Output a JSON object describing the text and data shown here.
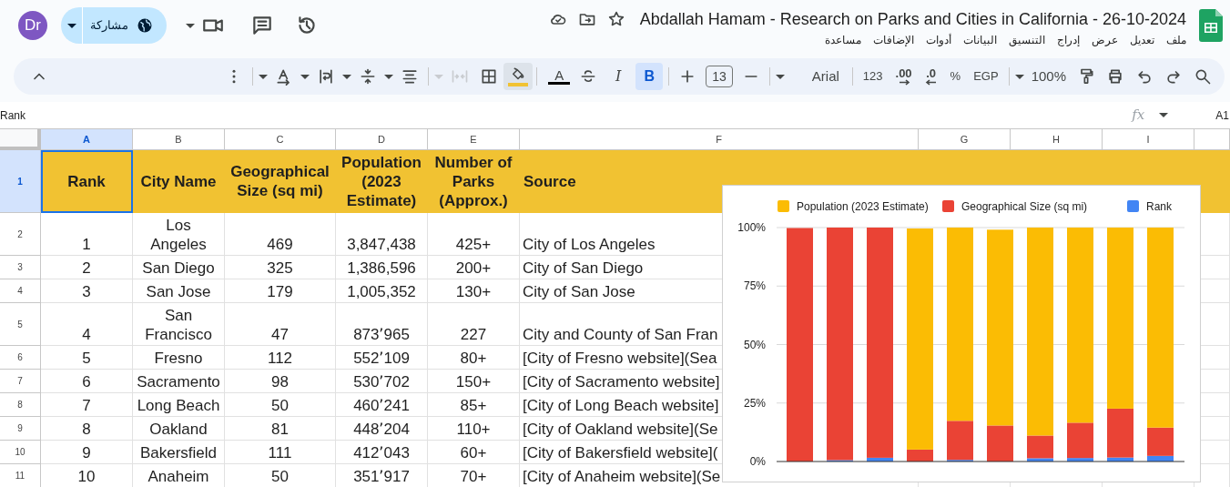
{
  "topbar": {
    "avatar": "Dr",
    "share": "مشاركة",
    "title": "Abdallah Hamam - Research on Parks and Cities in California - 26-10-2024",
    "menu": [
      "ملف",
      "تعديل",
      "عرض",
      "إدراج",
      "التنسيق",
      "البيانات",
      "أدوات",
      "الإضافات",
      "مساعدة"
    ]
  },
  "toolbar": [
    {
      "kind": "collapse",
      "disabled": false
    },
    {
      "kind": "spacer"
    },
    {
      "kind": "more",
      "disabled": false
    },
    {
      "kind": "divider"
    },
    {
      "kind": "caret",
      "disabled": false
    },
    {
      "kind": "rotate",
      "disabled": false
    },
    {
      "kind": "caret",
      "disabled": false
    },
    {
      "kind": "wrap",
      "disabled": false
    },
    {
      "kind": "caret",
      "disabled": false
    },
    {
      "kind": "valign",
      "disabled": false
    },
    {
      "kind": "caret",
      "disabled": false
    },
    {
      "kind": "halign",
      "disabled": false
    },
    {
      "kind": "divider"
    },
    {
      "kind": "caret",
      "disabled": true
    },
    {
      "kind": "merge",
      "disabled": true
    },
    {
      "kind": "borders",
      "disabled": false
    },
    {
      "kind": "fill",
      "disabled": false,
      "color": "#f1c232"
    },
    {
      "kind": "divider"
    },
    {
      "kind": "textcolor",
      "disabled": false,
      "label": "A",
      "color": "#000000"
    },
    {
      "kind": "strike",
      "disabled": false,
      "active": false
    },
    {
      "kind": "italic",
      "disabled": false,
      "label": "I",
      "active": false
    },
    {
      "kind": "bold",
      "disabled": false,
      "label": "B",
      "active": true
    },
    {
      "kind": "divider"
    },
    {
      "kind": "plus",
      "disabled": false
    },
    {
      "kind": "size",
      "disabled": false,
      "label": "13"
    },
    {
      "kind": "minus",
      "disabled": false
    },
    {
      "kind": "divider"
    },
    {
      "kind": "caret",
      "disabled": false
    },
    {
      "kind": "font",
      "disabled": false,
      "label": "Arial"
    },
    {
      "kind": "divider"
    },
    {
      "kind": "format",
      "disabled": false,
      "label": "123"
    },
    {
      "kind": "decimal_add",
      "disabled": false,
      "label": ".00"
    },
    {
      "kind": "decimal_remove",
      "disabled": false,
      "label": ".0"
    },
    {
      "kind": "format",
      "disabled": false,
      "label": "%"
    },
    {
      "kind": "format",
      "disabled": false,
      "label": "EGP"
    },
    {
      "kind": "divider"
    },
    {
      "kind": "caret",
      "disabled": false
    },
    {
      "kind": "zoom",
      "disabled": false,
      "label": "100%"
    },
    {
      "kind": "paint",
      "disabled": false
    },
    {
      "kind": "print",
      "disabled": false
    },
    {
      "kind": "undo",
      "disabled": false
    },
    {
      "kind": "redo",
      "disabled": false
    },
    {
      "kind": "search",
      "disabled": false
    }
  ],
  "formula_bar": {
    "content": "Rank",
    "fx": "fx",
    "cell": "A1"
  },
  "sheet": {
    "columns": [
      {
        "label": "A",
        "selected": true
      },
      {
        "label": "B",
        "selected": false
      },
      {
        "label": "C",
        "selected": false
      },
      {
        "label": "D",
        "selected": false
      },
      {
        "label": "E",
        "selected": false
      },
      {
        "label": "F",
        "selected": false
      },
      {
        "label": "G",
        "selected": false
      },
      {
        "label": "H",
        "selected": false
      },
      {
        "label": "I",
        "selected": false
      }
    ],
    "rows": [
      {
        "number": "1",
        "selected": true,
        "cells": [
          "Rank",
          "City Name",
          "Geographical Size (sq mi)",
          "Population (2023 Estimate)",
          "Number of Parks (Approx.)",
          "Source"
        ]
      },
      {
        "number": "2",
        "selected": false,
        "cells": [
          "1",
          "Los Angeles",
          "469",
          "3,847,438",
          "425+",
          "City of Los Angeles"
        ]
      },
      {
        "number": "3",
        "selected": false,
        "cells": [
          "2",
          "San Diego",
          "325",
          "1,386,596",
          "200+",
          "City of San Diego"
        ]
      },
      {
        "number": "4",
        "selected": false,
        "cells": [
          "3",
          "San Jose",
          "179",
          "1,005,352",
          "130+",
          "City of San Jose"
        ]
      },
      {
        "number": "5",
        "selected": false,
        "cells": [
          "4",
          "San Francisco",
          "47",
          "873٬965",
          "227",
          "City and County of San Fran"
        ]
      },
      {
        "number": "6",
        "selected": false,
        "cells": [
          "5",
          "Fresno",
          "112",
          "552٬109",
          "80+",
          "[City of Fresno website](Sea"
        ]
      },
      {
        "number": "7",
        "selected": false,
        "cells": [
          "6",
          "Sacramento",
          "98",
          "530٬702",
          "150+",
          "[City of Sacramento website]"
        ]
      },
      {
        "number": "8",
        "selected": false,
        "cells": [
          "7",
          "Long Beach",
          "50",
          "460٬241",
          "85+",
          "[City of Long Beach website]"
        ]
      },
      {
        "number": "9",
        "selected": false,
        "cells": [
          "8",
          "Oakland",
          "81",
          "448٬204",
          "110+",
          "[City of Oakland website](Se"
        ]
      },
      {
        "number": "10",
        "selected": false,
        "cells": [
          "9",
          "Bakersfield",
          "111",
          "412٬043",
          "60+",
          "[City of Bakersfield website]("
        ]
      },
      {
        "number": "11",
        "selected": false,
        "cells": [
          "10",
          "Anaheim",
          "50",
          "351٬917",
          "70+",
          "[City of Anaheim website](Se"
        ]
      }
    ]
  },
  "chart": {
    "chart_data": {
      "type": "bar",
      "stacked": true,
      "legend": "top",
      "grid": true,
      "ylim": [
        0,
        100
      ],
      "yticks": [
        {
          "value": 0,
          "label": "0%"
        },
        {
          "value": 25,
          "label": "25%"
        },
        {
          "value": 50,
          "label": "50%"
        },
        {
          "value": 75,
          "label": "75%"
        },
        {
          "value": 100,
          "label": "100%"
        }
      ],
      "series": [
        {
          "name": "Rank",
          "color": "#4285f4",
          "values": [
            null,
            0.6,
            1.6,
            null,
            0.7,
            null,
            1.4,
            1.5,
            1.7,
            2.4
          ]
        },
        {
          "name": "Geographical Size (sq mi)",
          "color": "#ea4335",
          "values": [
            99.8,
            99.4,
            98.4,
            5.1,
            16.7,
            15.4,
            9.7,
            15.1,
            20.9,
            12.1
          ]
        },
        {
          "name": "Population (2023 Estimate)",
          "color": "#fbbc04",
          "values": [
            0,
            0,
            0,
            94.5,
            82.6,
            83.7,
            88.9,
            83.4,
            77.4,
            85.5
          ]
        }
      ]
    }
  }
}
